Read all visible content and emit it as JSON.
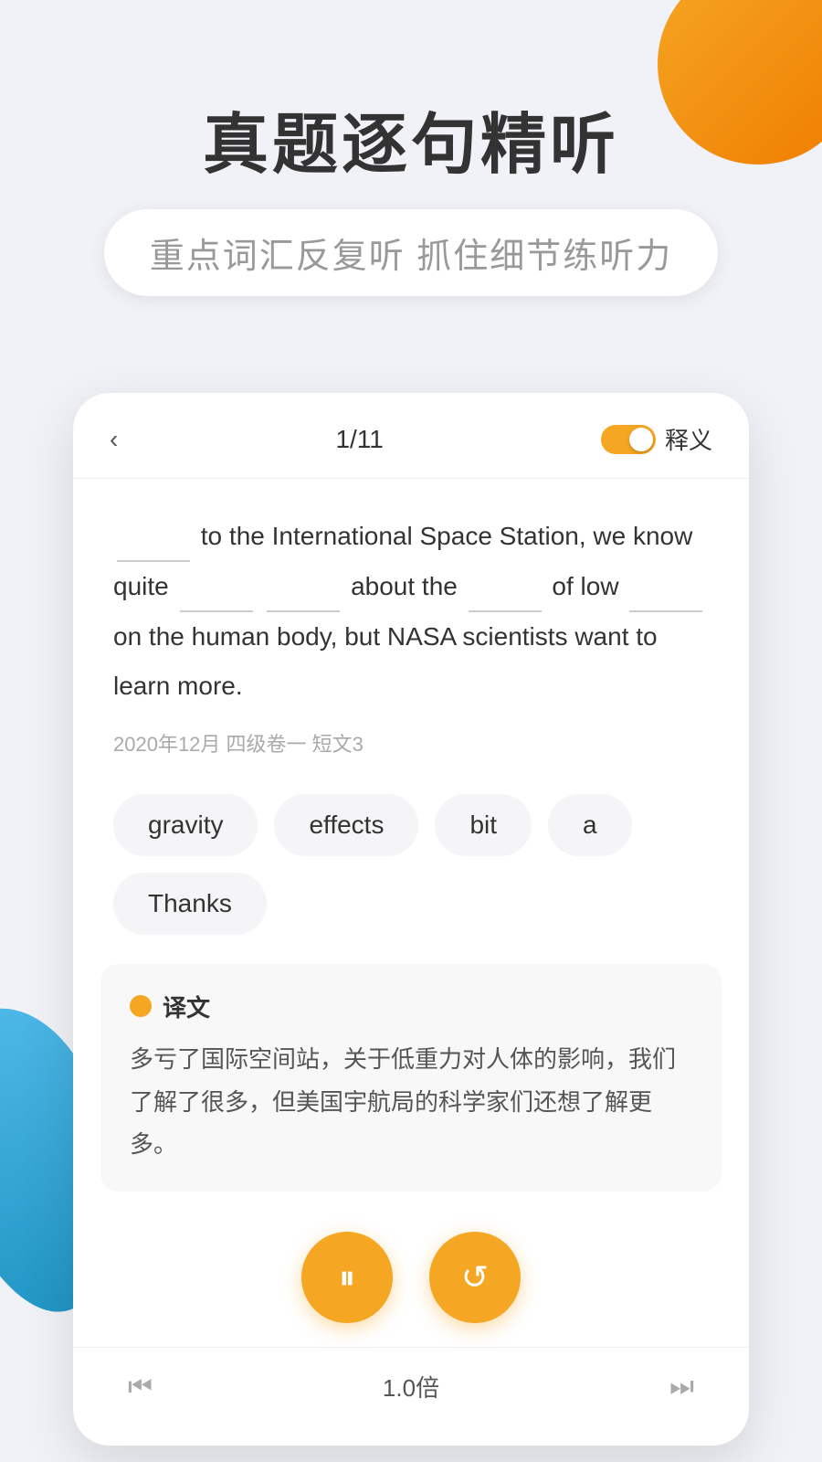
{
  "page": {
    "background_color": "#f0f2f7"
  },
  "header": {
    "main_title": "真题逐句精听",
    "subtitle": "重点词汇反复听  抓住细节练听力"
  },
  "card": {
    "nav": {
      "back_icon": "‹",
      "progress": "1/11",
      "toggle_label": "释义",
      "toggle_on": true
    },
    "passage": {
      "text_parts": [
        "________ to the International Space Station, we know quite ________ ________ about the ________ of low ________ on the human body, but NASA scientists want to learn more."
      ],
      "source": "2020年12月 四级卷一 短文3"
    },
    "word_chips": [
      {
        "id": "chip1",
        "text": "gravity"
      },
      {
        "id": "chip2",
        "text": "effects"
      },
      {
        "id": "chip3",
        "text": "bit"
      },
      {
        "id": "chip4",
        "text": "a"
      },
      {
        "id": "chip5",
        "text": "Thanks"
      }
    ],
    "translation": {
      "dot_color": "#f5a623",
      "title": "译文",
      "text": "多亏了国际空间站，关于低重力对人体的影响，我们了解了很多，但美国宇航局的科学家们还想了解更多。"
    },
    "player": {
      "pause_icon": "⏸",
      "refresh_icon": "↺"
    },
    "bottom_bar": {
      "prev_icon": "⏮",
      "speed": "1.0倍",
      "next_icon": "⏭"
    }
  }
}
